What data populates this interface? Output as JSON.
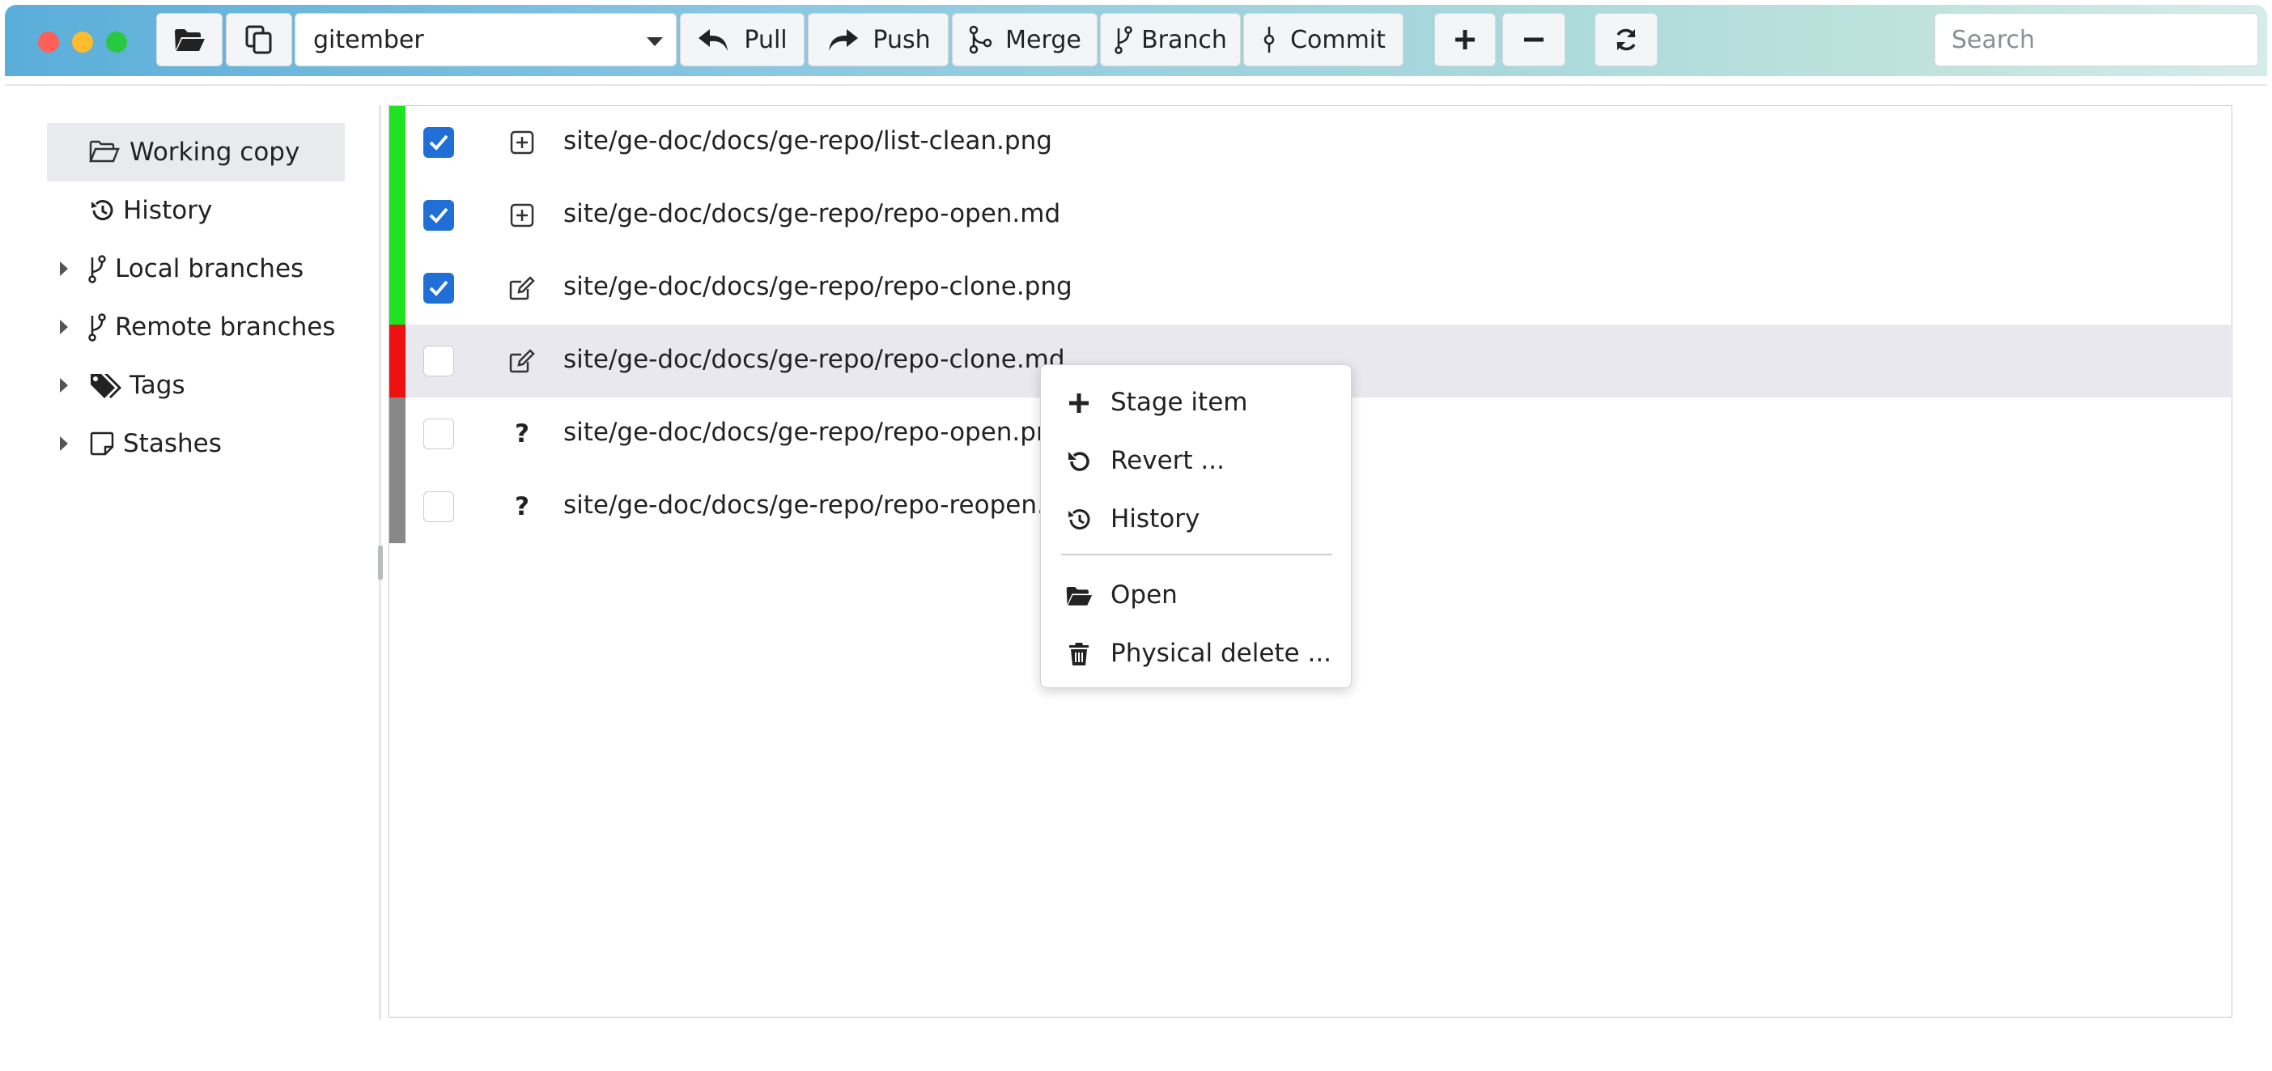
{
  "toolbar": {
    "repo_name": "gitember",
    "pull_label": "Pull",
    "push_label": "Push",
    "merge_label": "Merge",
    "branch_label": "Branch",
    "commit_label": "Commit",
    "search_placeholder": "Search"
  },
  "sidebar": {
    "items": [
      {
        "label": "Working copy",
        "icon": "folder-open-icon",
        "selected": true
      },
      {
        "label": "History",
        "icon": "history-icon"
      },
      {
        "label": "Local branches",
        "icon": "branch-icon",
        "expandable": true
      },
      {
        "label": "Remote branches",
        "icon": "branch-icon",
        "expandable": true
      },
      {
        "label": "Tags",
        "icon": "tags-icon",
        "expandable": true
      },
      {
        "label": "Stashes",
        "icon": "note-icon",
        "expandable": true
      }
    ]
  },
  "files": [
    {
      "path": "site/ge-doc/docs/ge-repo/list-clean.png",
      "checked": true,
      "status": "added",
      "status_color": "#1ee31e",
      "icon": "plus-square-icon"
    },
    {
      "path": "site/ge-doc/docs/ge-repo/repo-open.md",
      "checked": true,
      "status": "added",
      "status_color": "#1ee31e",
      "icon": "plus-square-icon"
    },
    {
      "path": "site/ge-doc/docs/ge-repo/repo-clone.png",
      "checked": true,
      "status": "modified",
      "status_color": "#1ee31e",
      "icon": "edit-icon"
    },
    {
      "path": "site/ge-doc/docs/ge-repo/repo-clone.md",
      "checked": false,
      "status": "modified",
      "status_color": "#ee1111",
      "icon": "edit-icon",
      "highlighted": true
    },
    {
      "path": "site/ge-doc/docs/ge-repo/repo-open.png",
      "checked": false,
      "status": "untracked",
      "status_color": "#888888",
      "icon": "question-icon"
    },
    {
      "path": "site/ge-doc/docs/ge-repo/repo-reopen.png",
      "checked": false,
      "status": "untracked",
      "status_color": "#888888",
      "icon": "question-icon"
    }
  ],
  "context_menu": {
    "items": [
      {
        "label": "Stage item",
        "icon": "plus-icon"
      },
      {
        "label": "Revert ...",
        "icon": "undo-icon"
      },
      {
        "label": "History",
        "icon": "history-icon"
      },
      {
        "label": "Open",
        "icon": "folder-open-icon"
      },
      {
        "label": "Physical delete ...",
        "icon": "trash-icon"
      }
    ]
  },
  "colors": {
    "accent": "#1f6fd6",
    "added": "#1ee31e",
    "conflict": "#ee1111",
    "untracked": "#888888"
  }
}
